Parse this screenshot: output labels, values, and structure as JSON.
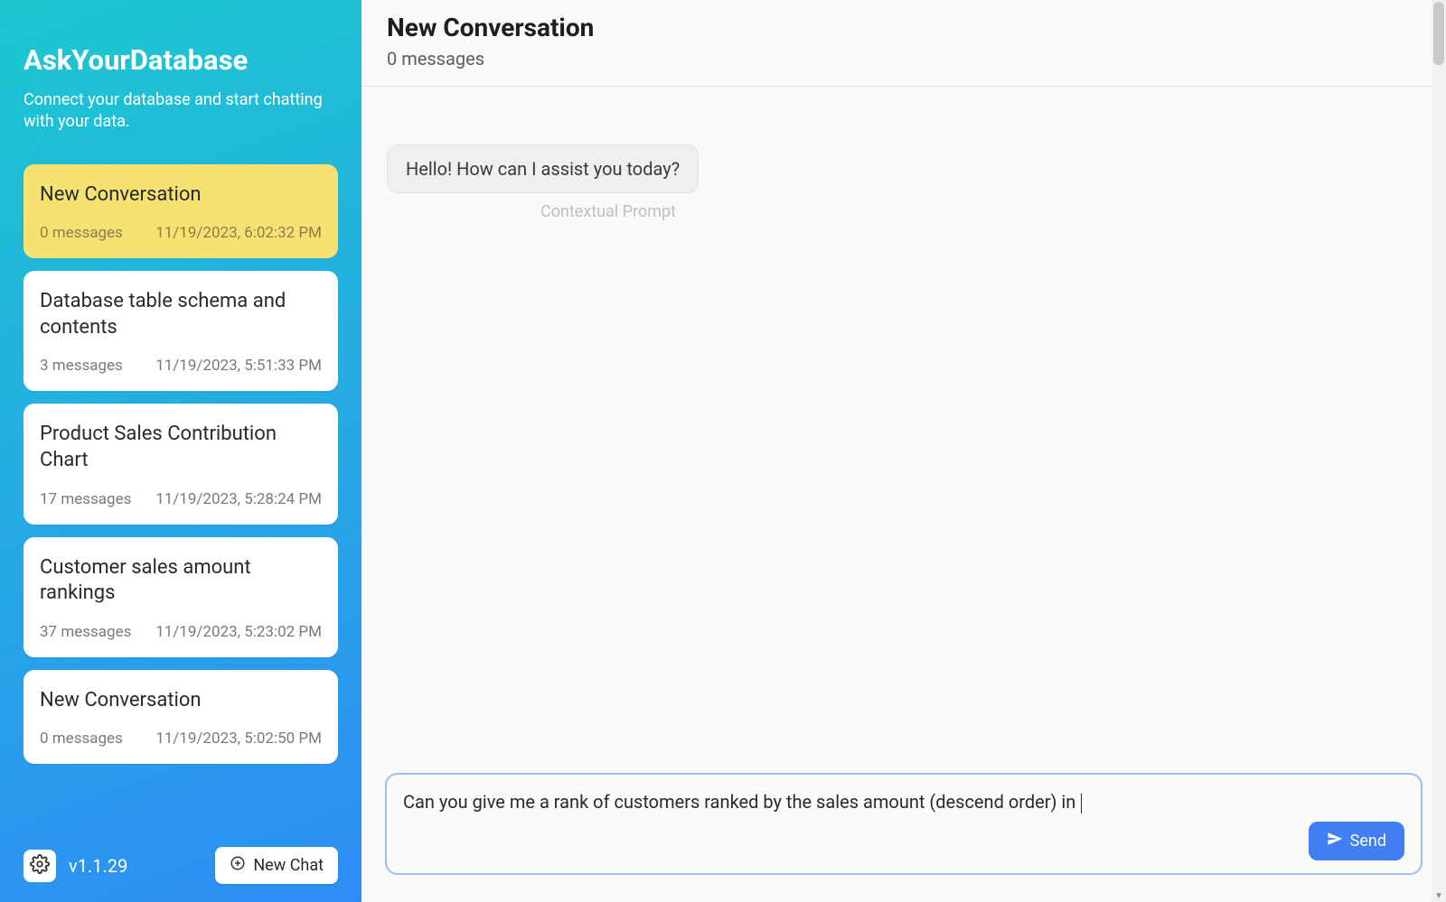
{
  "sidebar": {
    "app_title": "AskYourDatabase",
    "app_subtitle": "Connect your database and start chatting with your data.",
    "conversations": [
      {
        "title": "New Conversation",
        "messages": "0 messages",
        "timestamp": "11/19/2023, 6:02:32 PM",
        "active": true
      },
      {
        "title": "Database table schema and contents",
        "messages": "3 messages",
        "timestamp": "11/19/2023, 5:51:33 PM",
        "active": false
      },
      {
        "title": "Product Sales Contribution Chart",
        "messages": "17 messages",
        "timestamp": "11/19/2023, 5:28:24 PM",
        "active": false
      },
      {
        "title": "Customer sales amount rankings",
        "messages": "37 messages",
        "timestamp": "11/19/2023, 5:23:02 PM",
        "active": false
      },
      {
        "title": "New Conversation",
        "messages": "0 messages",
        "timestamp": "11/19/2023, 5:02:50 PM",
        "active": false
      }
    ],
    "version": "v1.1.29",
    "new_chat_label": "New Chat"
  },
  "header": {
    "title": "New Conversation",
    "subtitle": "0 messages"
  },
  "chat": {
    "greeting": "Hello! How can I assist you today?",
    "context_label": "Contextual Prompt"
  },
  "input": {
    "value": "Can you give me a rank of customers ranked by the sales amount (descend order) in ",
    "send_label": "Send"
  }
}
